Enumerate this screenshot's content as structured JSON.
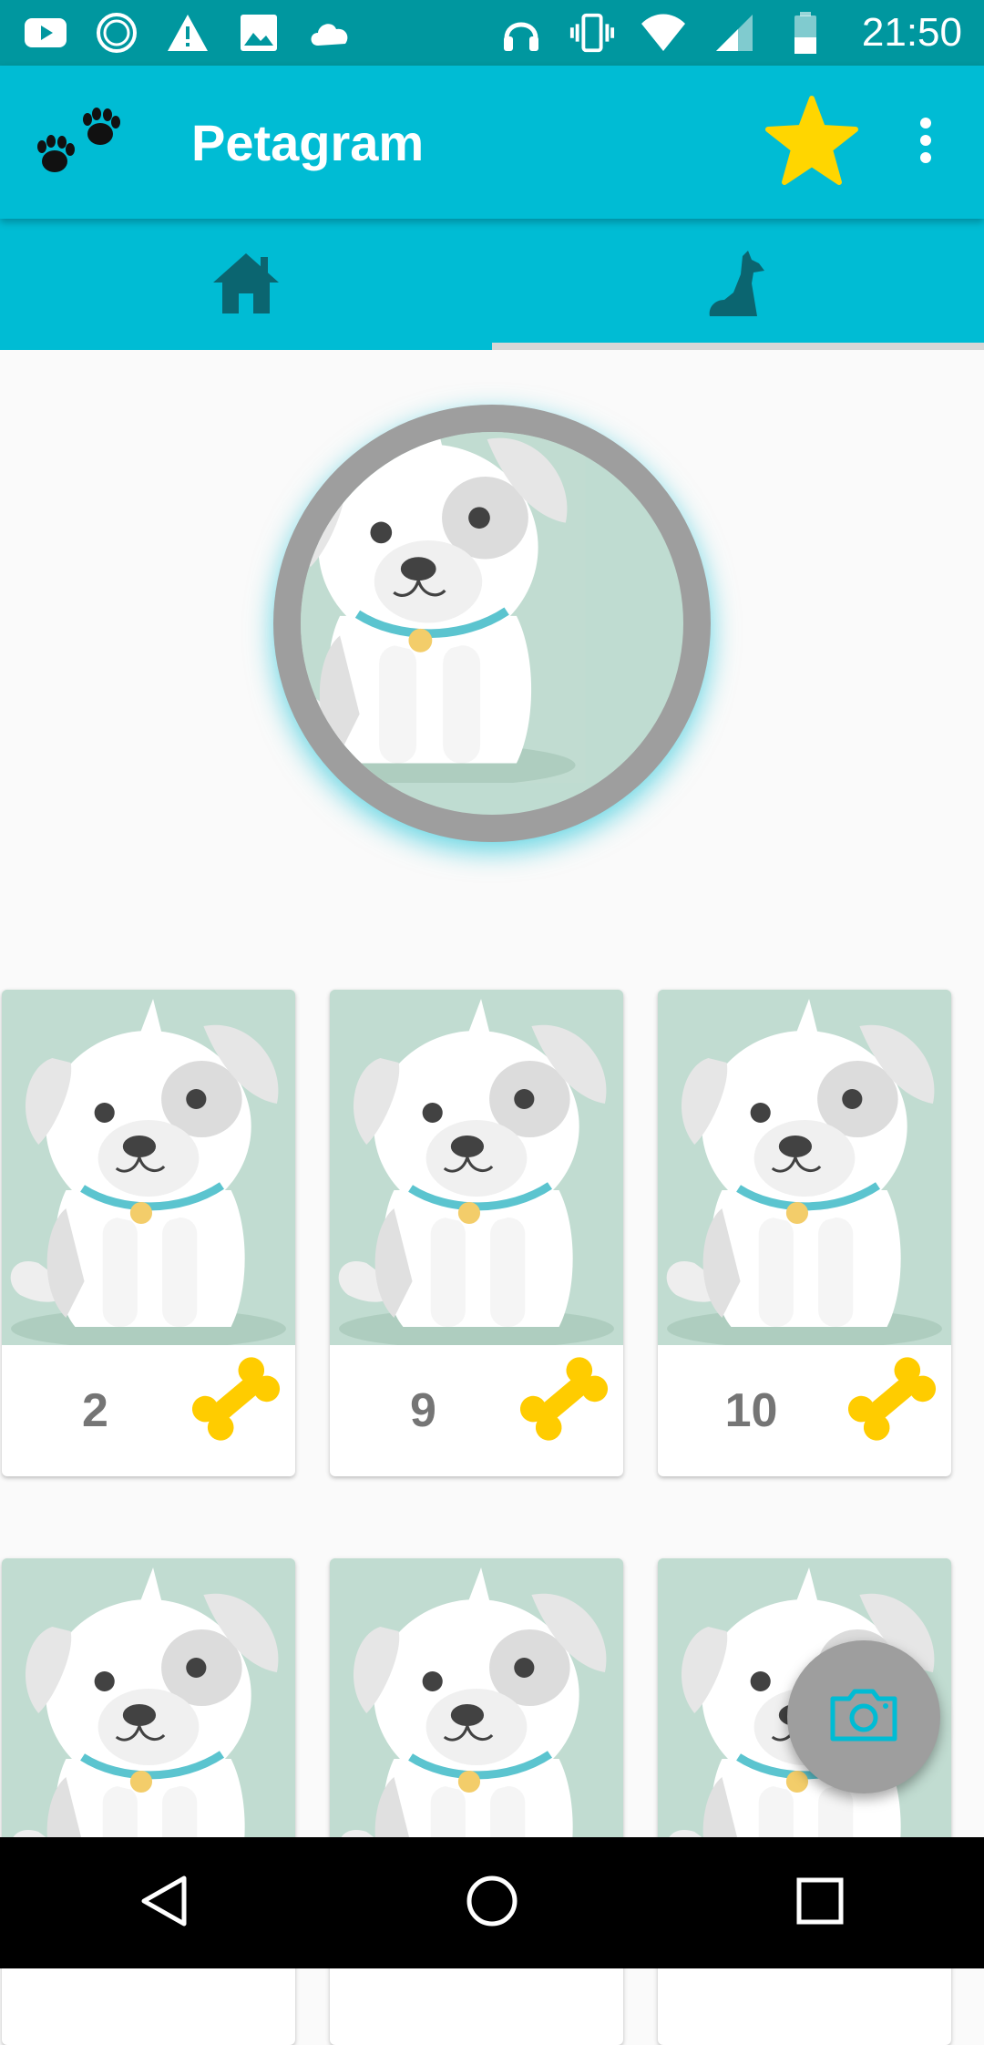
{
  "status_bar": {
    "time": "21:50",
    "left_icons": [
      "youtube-icon",
      "sync-icon",
      "warning-icon",
      "image-icon",
      "cloud-icon"
    ],
    "right_icons": [
      "headphones-icon",
      "vibrate-icon",
      "wifi-icon",
      "signal-icon",
      "battery-icon"
    ]
  },
  "app_bar": {
    "title": "Petagram",
    "logo_icon": "paw-prints-icon",
    "favorite_icon": "star-icon",
    "menu_icon": "more-vert-icon"
  },
  "tabs": [
    {
      "icon": "home-icon",
      "selected": false
    },
    {
      "icon": "dog-icon",
      "selected": true
    }
  ],
  "profile": {
    "photo": "puppy-avatar"
  },
  "grid": {
    "like_icon": "bone-icon",
    "items": [
      {
        "likes": "2"
      },
      {
        "likes": "9"
      },
      {
        "likes": "10"
      },
      {
        "likes": ""
      },
      {
        "likes": ""
      },
      {
        "likes": ""
      }
    ]
  },
  "fab": {
    "icon": "camera-icon"
  },
  "nav_bar": {
    "icons": [
      "back-icon",
      "home-circle-icon",
      "recents-icon"
    ]
  },
  "colors": {
    "status_bar": "#00979f",
    "primary": "#00bcd4",
    "accent_star": "#ffd600",
    "bone": "#ffcc00",
    "fab": "#9e9e9e"
  }
}
